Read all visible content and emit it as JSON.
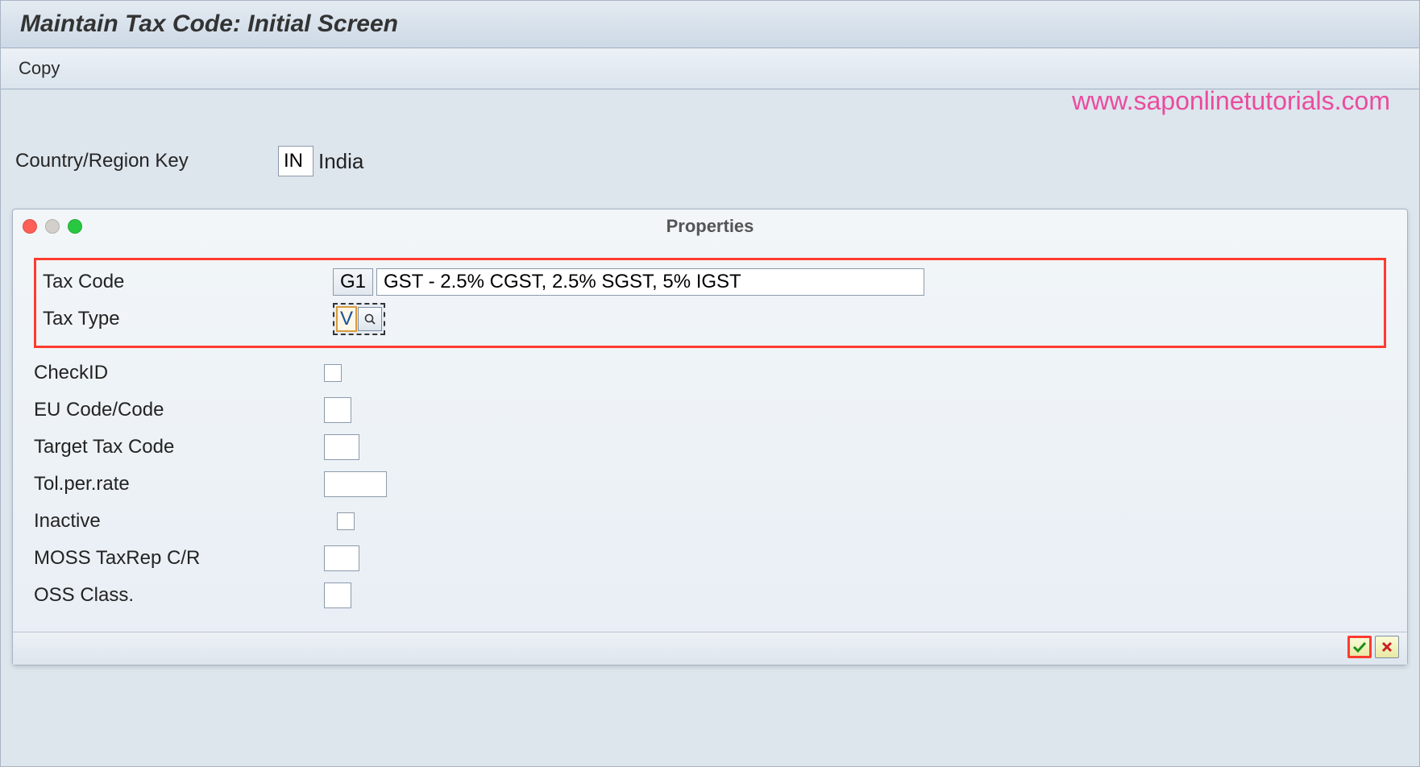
{
  "header": {
    "title": "Maintain Tax Code: Initial Screen"
  },
  "toolbar": {
    "copy_label": "Copy"
  },
  "main": {
    "country_label": "Country/Region Key",
    "country_code": "IN",
    "country_name": "India"
  },
  "watermark": "www.saponlinetutorials.com",
  "dialog": {
    "title": "Properties",
    "fields": {
      "tax_code_label": "Tax Code",
      "tax_code_value": "G1",
      "tax_code_desc": "GST - 2.5% CGST, 2.5% SGST, 5% IGST",
      "tax_type_label": "Tax Type",
      "tax_type_value": "V",
      "checkid_label": "CheckID",
      "eu_code_label": "EU Code/Code",
      "eu_code_value": "",
      "target_tax_label": "Target Tax Code",
      "target_tax_value": "",
      "tol_rate_label": "Tol.per.rate",
      "tol_rate_value": "",
      "inactive_label": "Inactive",
      "moss_label": "MOSS TaxRep C/R",
      "moss_value": "",
      "oss_label": "OSS Class.",
      "oss_value": ""
    }
  }
}
